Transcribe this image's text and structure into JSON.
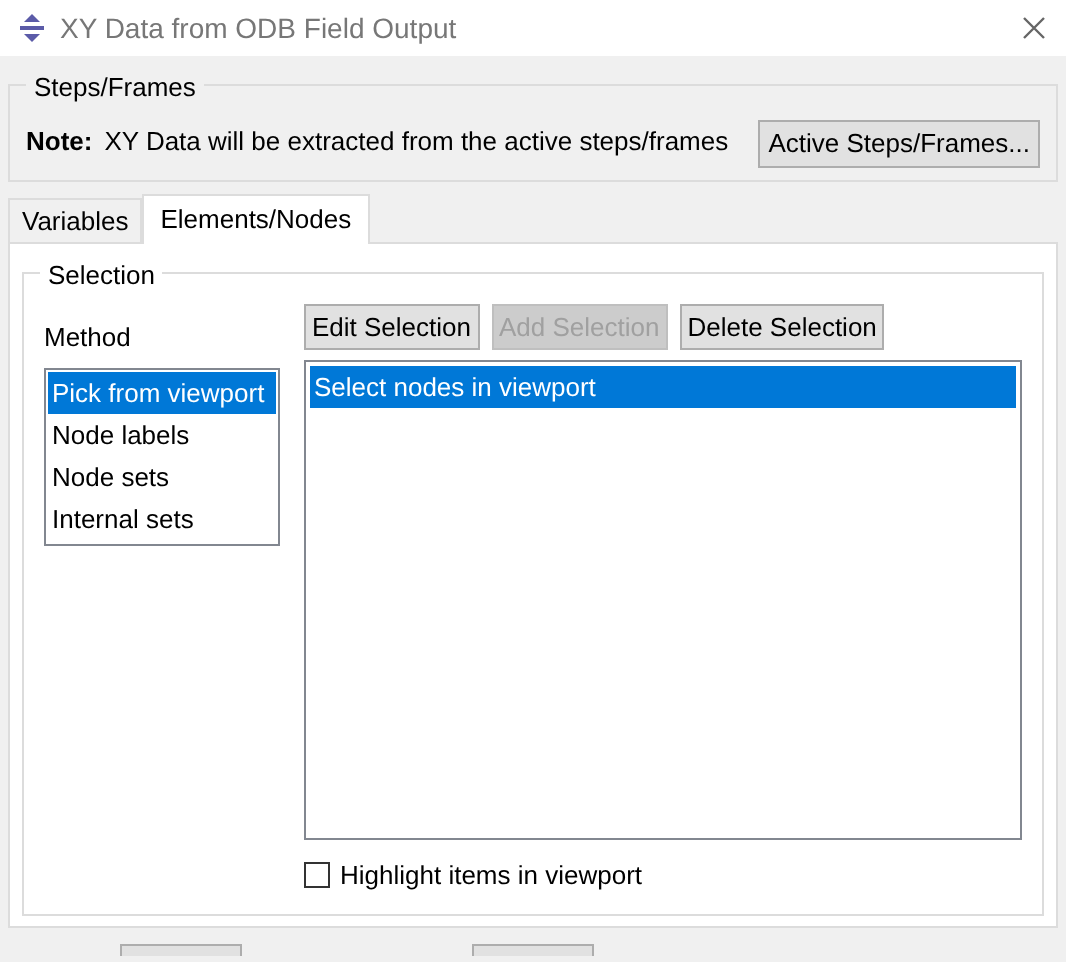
{
  "window": {
    "title": "XY Data from ODB Field Output"
  },
  "steps_frames": {
    "title": "Steps/Frames",
    "note_label": "Note:",
    "note": "XY Data will be extracted from the active steps/frames",
    "button": "Active Steps/Frames..."
  },
  "tabs": [
    {
      "label": "Variables",
      "selected": false
    },
    {
      "label": "Elements/Nodes",
      "selected": true
    }
  ],
  "selection": {
    "title": "Selection",
    "method_label": "Method",
    "methods": [
      {
        "label": "Pick from viewport",
        "selected": true
      },
      {
        "label": "Node labels",
        "selected": false
      },
      {
        "label": "Node sets",
        "selected": false
      },
      {
        "label": "Internal sets",
        "selected": false
      }
    ],
    "buttons": [
      {
        "label": "Edit Selection",
        "disabled": false
      },
      {
        "label": "Add Selection",
        "disabled": true
      },
      {
        "label": "Delete Selection",
        "disabled": false
      }
    ],
    "items": [
      {
        "label": "Select nodes in viewport",
        "selected": true
      }
    ],
    "highlight": {
      "label": "Highlight items in viewport",
      "checked": false
    }
  }
}
